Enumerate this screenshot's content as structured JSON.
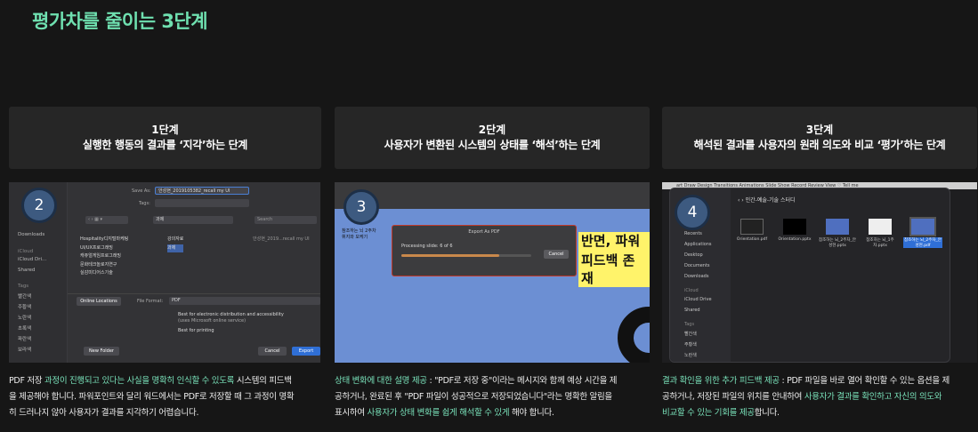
{
  "title": "평가차를 줄이는 3단계",
  "steps": [
    {
      "step": "1단계",
      "desc": "실행한 행동의 결과를 ‘지각’하는 단계",
      "badge": "2",
      "caption_line1_a": "PDF 저장 ",
      "caption_line1_hl": "과정이 진행되고 있다는 사실을 명확히 인식할 수 있도록",
      "caption_line1_b": " 시스템의 피드백",
      "caption_line2": "을 제공해야 합니다. 파워포인트와 달리 워드에서는 PDF로 저장할 때 그 과정이 명확",
      "caption_line3": "히 드러나지 않아 사용자가 결과를 지각하기 어렵습니다.",
      "shot": {
        "save_as_label": "Save As:",
        "save_as_value": "안성현_2019105382_recall my UI",
        "tags_label": "Tags:",
        "folder_name": "과제",
        "search_placeholder": "Search",
        "sidebar": [
          "Downloads",
          "iCloud",
          "iCloud Dri...",
          "Shared",
          "Tags",
          "빨간색",
          "주황색",
          "노란색",
          "초록색",
          "파란색",
          "보라색"
        ],
        "folders_col1": [
          "Hospitality디지털마케팅",
          "UI/UX프로그래밍",
          "캐쥬얼게임프로그래밍",
          "문화테크놀로지연구",
          "실감미디어스기술"
        ],
        "folders_col2": [
          "강의자료",
          "과제"
        ],
        "file_preview": "안성현_2019...recall my UI",
        "online_locations": "Online Locations",
        "file_format_label": "File Format:",
        "file_format_value": "PDF",
        "option1": "Best for electronic distribution and accessibility",
        "option1_sub": "(uses Microsoft online service)",
        "option2": "Best for printing",
        "new_folder": "New Folder",
        "cancel": "Cancel",
        "export": "Export"
      }
    },
    {
      "step": "2단계",
      "desc": "사용자가 변환된 시스템의 상태를 ‘해석’하는 단계",
      "badge": "3",
      "caption_line1_hl": "상태 변화에 대한 설명 제공",
      "caption_line1_b": " : \"PDF로 저장 중\"이라는 메시지와 함께 예상 시간을 제",
      "caption_line2": "공하거나, 완료된 후 \"PDF 파일이 성공적으로 저장되었습니다\"라는 명확한 알림을",
      "caption_line3_a": "표시하여 ",
      "caption_line3_hl": "사용자가 상태 변화를 쉽게 해석할 수 있게",
      "caption_line3_b": " 해야 합니다.",
      "shot": {
        "dialog_title": "Export As PDF",
        "processing": "Processing slide: 6 of 6",
        "cancel": "Cancel",
        "slide_text_1": "참조하는 뇌 2주차",
        "slide_text_2": "휘지와 모케기",
        "yellow1": "반면, 파워포",
        "yellow2": "피드백 존재",
        "progress": 0.75
      }
    },
    {
      "step": "3단계",
      "desc": "해석된 결과를 사용자의 원래 의도와 비교 ‘평가’하는 단계",
      "badge": "4",
      "caption_line1_hl": "결과 확인을 위한 추가 피드백 제공",
      "caption_line1_b": " : PDF 파일을 바로 열어 확인할 수 있는 옵션을 제",
      "caption_line2_a": "공하거나, 저장된 파일의 위치를 안내하여 ",
      "caption_line2_hl": "사용자가 결과를 확인하고 자신의 의도와",
      "caption_line3_hl": "비교할 수 있는 기회를 제공",
      "caption_line3_b": "합니다.",
      "shot": {
        "menu": "art   Draw   Design   Transitions   Animations   Slide Show   Record   Review   View   ♡ Tell me",
        "window_title": "인간-예술-기술 스터디",
        "sidebar": [
          "Recents",
          "Applications",
          "Desktop",
          "Documents",
          "Downloads",
          "iCloud",
          "iCloud Drive",
          "Shared",
          "Tags",
          "빨간색",
          "주황색",
          "노란색"
        ],
        "files": [
          "Orientation.pdf",
          "Orientation.pptx",
          "참조하는 뇌_2주차_안성현.pptx",
          "참조하는 뇌_1주차.pptx",
          "참조하는 뇌_2주차_안성현.pdf"
        ]
      }
    }
  ]
}
